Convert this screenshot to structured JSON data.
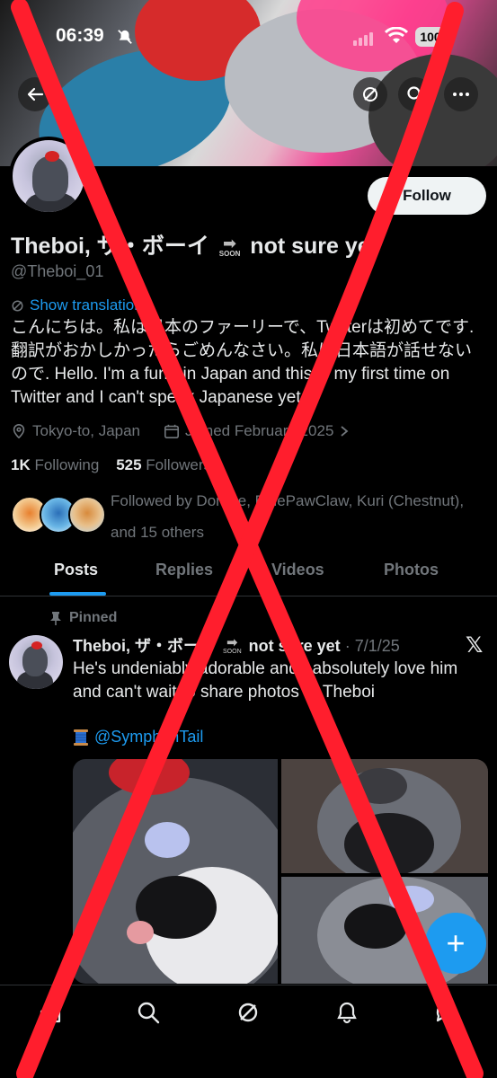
{
  "status_bar": {
    "time": "06:39",
    "battery": "100"
  },
  "profile": {
    "display_name": "Theboi, ザ・ボーイ",
    "soon_badge": "SOON",
    "name_suffix": "not sure yet",
    "handle": "@Theboi_01",
    "follow_label": "Follow",
    "show_translation": "Show translation",
    "bio": "こんにちは。私は日本のファーリーで、Twitterは初めてです. 翻訳がおかしかったらごめんなさい。私は日本語が話せないので. Hello. I'm a furry in Japan and this is my first time on Twitter and I can't speak Japanese yet.",
    "location": "Tokyo-to, Japan",
    "joined": "Joined February 2025",
    "following_count": "1K",
    "following_label": "Following",
    "followers_count": "525",
    "followers_label": "Followers",
    "followed_by": "Followed by Dorbee, BluePawClaw, Kuri (Chestnut), and 15 others"
  },
  "tabs": [
    {
      "label": "Posts",
      "active": true
    },
    {
      "label": "Replies",
      "active": false
    },
    {
      "label": "Videos",
      "active": false
    },
    {
      "label": "Photos",
      "active": false
    }
  ],
  "pinned_post": {
    "pinned_label": "Pinned",
    "author": "Theboi, ザ・ボーイ",
    "soon_badge": "SOON",
    "author_suffix": "not sure yet",
    "date": "· 7/1/25",
    "text": "He's undeniably adorable and I absolutely love him and can't wait to share photos of Theboi",
    "mention": "@SymphonTail"
  },
  "colors": {
    "accent": "#1d9bf0",
    "background": "#000000",
    "overlay_x": "#ff1e2d"
  },
  "icons": {
    "back": "arrow-left-icon",
    "grok": "grok-icon",
    "search": "search-icon",
    "more": "more-icon",
    "location": "location-pin-icon",
    "calendar": "calendar-icon",
    "pin": "pin-icon",
    "spool": "thread-spool-icon",
    "nav": [
      "home-icon",
      "search-icon",
      "grok-icon",
      "notifications-icon",
      "messages-icon"
    ]
  }
}
